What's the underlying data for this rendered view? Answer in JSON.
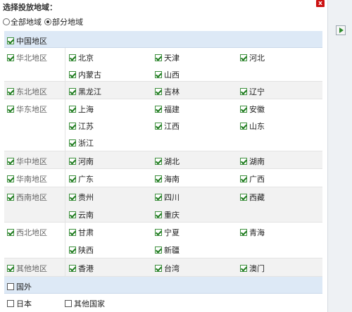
{
  "title": "选择投放地域：",
  "close_label": "x",
  "scope": {
    "all_label": "全部地域",
    "partial_label": "部分地域",
    "selected": "partial"
  },
  "china": {
    "label": "中国地区"
  },
  "regions": [
    {
      "label": "华北地区",
      "provinces": [
        "北京",
        "天津",
        "河北",
        "内蒙古",
        "山西"
      ]
    },
    {
      "label": "东北地区",
      "provinces": [
        "黑龙江",
        "吉林",
        "辽宁"
      ]
    },
    {
      "label": "华东地区",
      "provinces": [
        "上海",
        "福建",
        "安徽",
        "江苏",
        "江西",
        "山东",
        "浙江"
      ]
    },
    {
      "label": "华中地区",
      "provinces": [
        "河南",
        "湖北",
        "湖南"
      ]
    },
    {
      "label": "华南地区",
      "provinces": [
        "广东",
        "海南",
        "广西"
      ]
    },
    {
      "label": "西南地区",
      "provinces": [
        "贵州",
        "四川",
        "西藏",
        "云南",
        "重庆"
      ]
    },
    {
      "label": "西北地区",
      "provinces": [
        "甘肃",
        "宁夏",
        "青海",
        "陕西",
        "新疆"
      ]
    },
    {
      "label": "其他地区",
      "provinces": [
        "香港",
        "台湾",
        "澳门"
      ]
    }
  ],
  "abroad": {
    "label": "国外",
    "items": [
      "日本",
      "其他国家"
    ]
  }
}
